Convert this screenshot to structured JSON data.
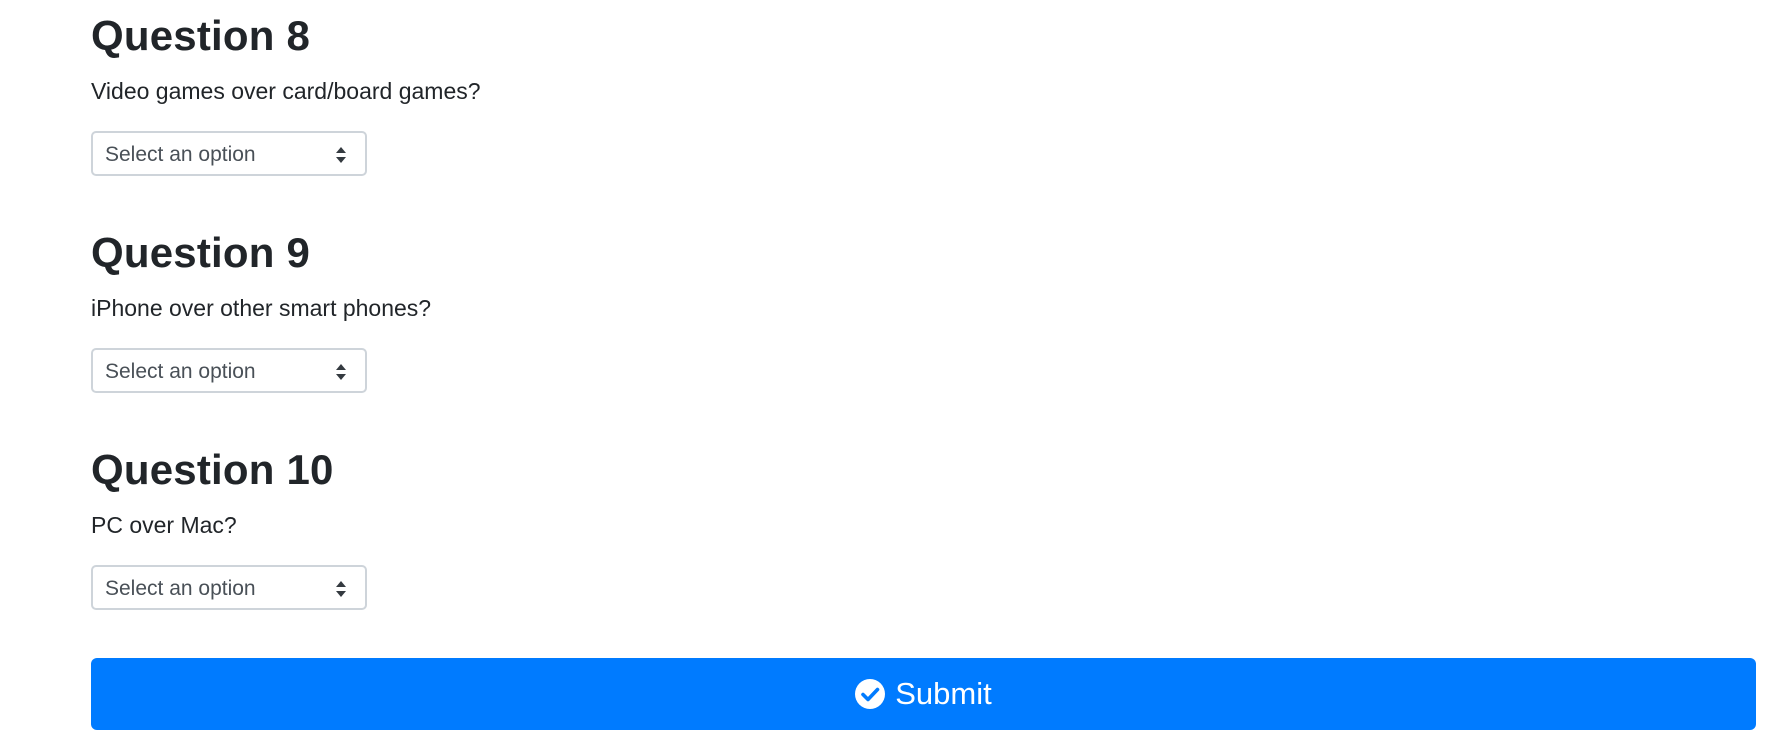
{
  "questions": [
    {
      "title": "Question 8",
      "text": "Video games over card/board games?",
      "select_value": "Select an option"
    },
    {
      "title": "Question 9",
      "text": "iPhone over other smart phones?",
      "select_value": "Select an option"
    },
    {
      "title": "Question 10",
      "text": "PC over Mac?",
      "select_value": "Select an option"
    }
  ],
  "submit": {
    "label": "Submit",
    "icon": "check-circle-icon",
    "color": "#007bff"
  },
  "icons": {
    "select": "sort-arrows-icon"
  }
}
